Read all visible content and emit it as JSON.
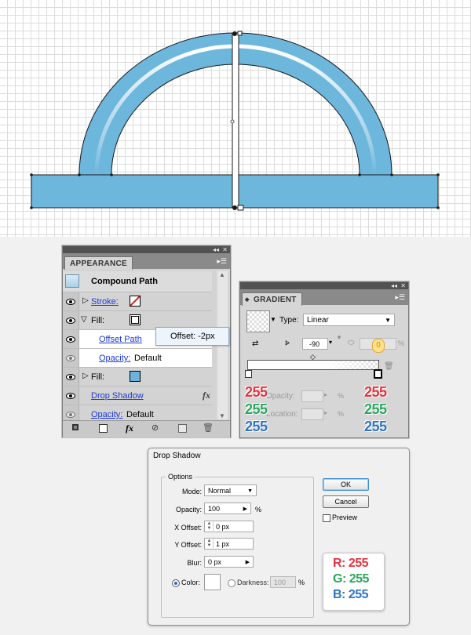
{
  "appearance": {
    "tab": "APPEARANCE",
    "header": "Compound Path",
    "items": {
      "stroke": "Stroke:",
      "fill1": "Fill:",
      "offset_path": "Offset Path",
      "opacity1": "Opacity:",
      "opacity1_value": "Default",
      "fill2": "Fill:",
      "drop_shadow": "Drop Shadow",
      "fx": "fx",
      "opacity2": "Opacity:",
      "opacity2_value": "Default"
    },
    "tooltip": "Offset: -2px",
    "fill2_color": "#6ab4dc"
  },
  "gradient": {
    "tab": "GRADIENT",
    "type_label": "Type:",
    "type_value": "Linear",
    "angle": "-90",
    "angle_unit": "°",
    "aspect_value": "0",
    "percent": "%",
    "opacity_label": "Opacity:",
    "location_label": "Location:",
    "left_rgb": [
      "255",
      "255",
      "255"
    ],
    "right_rgb": [
      "255",
      "255",
      "255"
    ]
  },
  "drop_shadow": {
    "title": "Drop Shadow",
    "options_label": "Options",
    "mode_label": "Mode:",
    "mode_value": "Normal",
    "opacity_label": "Opacity:",
    "opacity_value": "100",
    "opacity_unit": "%",
    "x_label": "X Offset:",
    "x_value": "0 px",
    "y_label": "Y Offset:",
    "y_value": "1 px",
    "blur_label": "Blur:",
    "blur_value": "0 px",
    "color_label": "Color:",
    "darkness_label": "Darkness:",
    "darkness_value": "100",
    "darkness_unit": "%",
    "ok": "OK",
    "cancel": "Cancel",
    "preview": "Preview",
    "rgb": {
      "r": "R: 255",
      "g": "G: 255",
      "b": "B: 255"
    }
  }
}
